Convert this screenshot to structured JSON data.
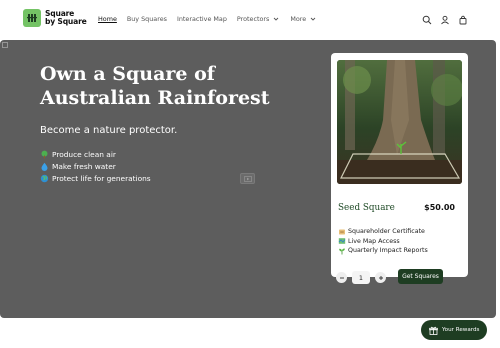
{
  "brand": {
    "name_line1": "Square",
    "name_line2": "by Square",
    "accent": "#74c365"
  },
  "nav": {
    "items": [
      {
        "label": "Home",
        "active": true,
        "dropdown": false
      },
      {
        "label": "Buy Squares",
        "active": false,
        "dropdown": false
      },
      {
        "label": "Interactive Map",
        "active": false,
        "dropdown": false
      },
      {
        "label": "Protectors",
        "active": false,
        "dropdown": true
      },
      {
        "label": "More",
        "active": false,
        "dropdown": true
      }
    ]
  },
  "header_icons": [
    "search-icon",
    "account-icon",
    "cart-icon"
  ],
  "hero": {
    "title_line1": "Own a Square of",
    "title_line2": "Australian Rainforest",
    "subtitle": "Become a nature protector.",
    "bullets": [
      {
        "icon": "tree-icon",
        "text": "Produce clean air"
      },
      {
        "icon": "droplet-icon",
        "text": "Make fresh water"
      },
      {
        "icon": "globe-icon",
        "text": "Protect life for generations"
      }
    ],
    "background": "#5d5d5d"
  },
  "product": {
    "title": "Seed Square",
    "price": "$50.00",
    "features": [
      {
        "icon": "scroll-icon",
        "text": "Squareholder Certificate"
      },
      {
        "icon": "map-icon",
        "text": "Live Map Access"
      },
      {
        "icon": "seedling-icon",
        "text": "Quarterly Impact Reports"
      }
    ],
    "quantity": "1",
    "button_label": "Get Squares",
    "button_color": "#1e3d22"
  },
  "rewards": {
    "label": "Your Rewards"
  }
}
